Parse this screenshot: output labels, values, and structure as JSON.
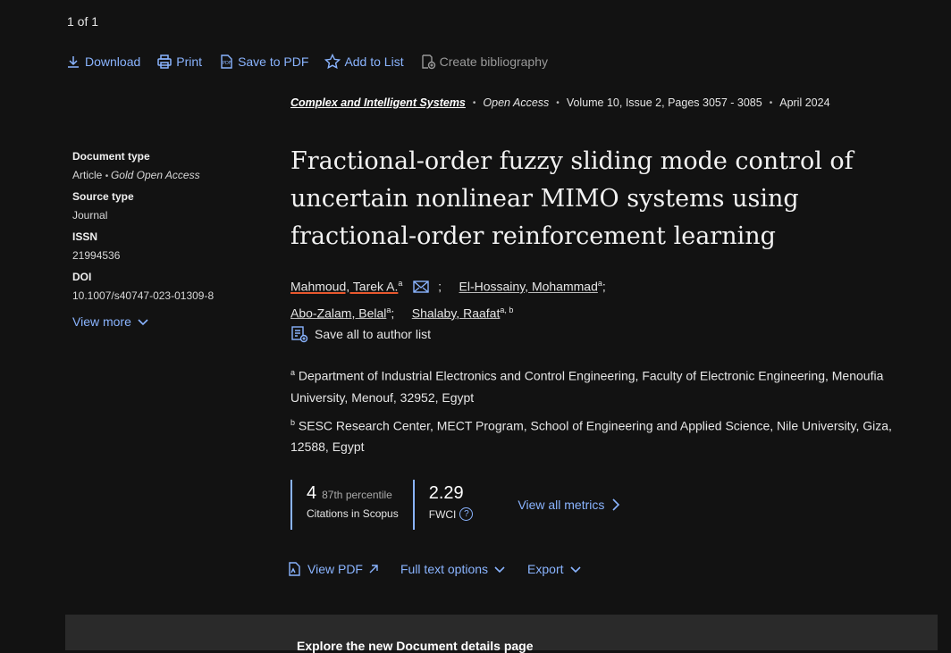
{
  "pager": "1 of 1",
  "toolbar": {
    "download": "Download",
    "print": "Print",
    "save_pdf": "Save to PDF",
    "add_list": "Add to List",
    "bibliography": "Create bibliography"
  },
  "source": {
    "journal": "Complex and Intelligent Systems",
    "access": "Open Access",
    "volume": "Volume 10, Issue 2, Pages 3057 - 3085",
    "date": "April 2024"
  },
  "sidebar": {
    "doc_type_label": "Document type",
    "doc_type_value": "Article",
    "doc_type_oa": "Gold Open Access",
    "source_type_label": "Source type",
    "source_type_value": "Journal",
    "issn_label": "ISSN",
    "issn_value": "21994536",
    "doi_label": "DOI",
    "doi_value": "10.1007/s40747-023-01309-8",
    "view_more": "View more"
  },
  "title": "Fractional-order fuzzy sliding mode control of uncertain nonlinear MIMO systems using fractional-order reinforcement learning",
  "authors": [
    {
      "name": "Mahmoud, Tarek A.",
      "sup": "a"
    },
    {
      "name": "El-Hossainy, Mohammad",
      "sup": "a"
    },
    {
      "name": "Abo-Zalam, Belal",
      "sup": "a"
    },
    {
      "name": "Shalaby, Raafat",
      "sup": "a, b"
    }
  ],
  "save_authors": "Save all to author list",
  "affiliations": [
    {
      "sup": "a",
      "text": "Department of Industrial Electronics and Control Engineering, Faculty of Electronic Engineering, Menoufia University, Menouf, 32952, Egypt"
    },
    {
      "sup": "b",
      "text": "SESC Research Center, MECT Program, School of Engineering and Applied Science, Nile University, Giza, 12588, Egypt"
    }
  ],
  "metrics": {
    "citations": "4",
    "percentile": "87th percentile",
    "citations_caption": "Citations in Scopus",
    "fwci": "2.29",
    "fwci_caption": "FWCI",
    "view_all": "View all metrics"
  },
  "actions": {
    "view_pdf": "View PDF",
    "full_text": "Full text options",
    "export": "Export"
  },
  "banner": "Explore the new Document details page",
  "colors": {
    "link": "#8ab4ff",
    "background": "#121212",
    "first_author_underline": "#e8582e"
  }
}
